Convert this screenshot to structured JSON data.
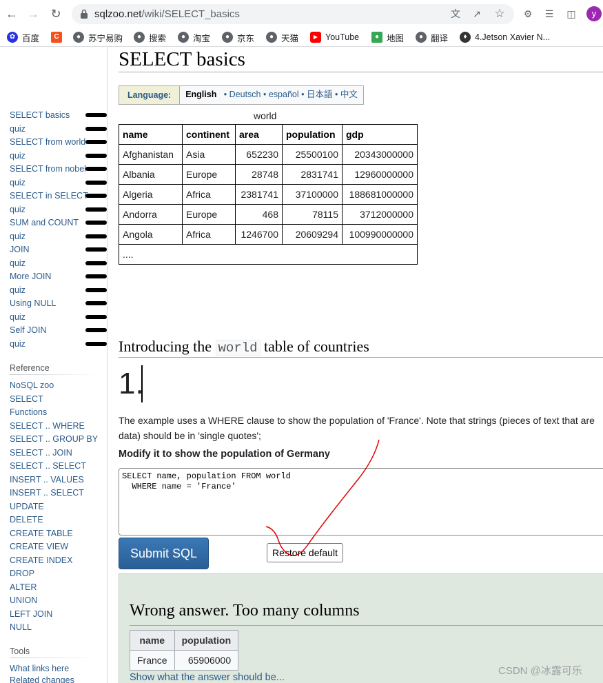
{
  "browser": {
    "url_host": "sqlzoo.net",
    "url_path": "/wiki/SELECT_basics",
    "avatar_letter": "y",
    "bookmarks": [
      {
        "label": "百度",
        "icon": "baidu-icon",
        "color": "#2932e1"
      },
      {
        "label": "",
        "icon": "c-app-icon",
        "color": "#f4511e"
      },
      {
        "label": "苏宁易购",
        "icon": "globe-icon",
        "color": "#5f6368"
      },
      {
        "label": "搜索",
        "icon": "globe-icon",
        "color": "#5f6368"
      },
      {
        "label": "淘宝",
        "icon": "globe-icon",
        "color": "#5f6368"
      },
      {
        "label": "京东",
        "icon": "globe-icon",
        "color": "#5f6368"
      },
      {
        "label": "天猫",
        "icon": "globe-icon",
        "color": "#5f6368"
      },
      {
        "label": "YouTube",
        "icon": "youtube-icon",
        "color": "#ff0000"
      },
      {
        "label": "地图",
        "icon": "maps-icon",
        "color": "#34a853"
      },
      {
        "label": "翻译",
        "icon": "globe-icon",
        "color": "#5f6368"
      },
      {
        "label": "4.Jetson Xavier N...",
        "icon": "bookmark-icon",
        "color": "#333333"
      }
    ]
  },
  "sidebar": {
    "tutorial_links": [
      "SELECT basics",
      "quiz",
      "SELECT from world",
      "quiz",
      "SELECT from nobel",
      "quiz",
      "SELECT in SELECT",
      "quiz",
      "SUM and COUNT",
      "quiz",
      "JOIN",
      "quiz",
      "More JOIN",
      "quiz",
      "Using NULL",
      "quiz",
      "Self JOIN",
      "quiz"
    ],
    "reference_heading": "Reference",
    "reference_links": [
      "NoSQL zoo",
      "SELECT",
      "Functions",
      "SELECT .. WHERE",
      "SELECT .. GROUP BY",
      "SELECT .. JOIN",
      "SELECT .. SELECT",
      "INSERT .. VALUES",
      "INSERT .. SELECT",
      "UPDATE",
      "DELETE",
      "CREATE TABLE",
      "CREATE VIEW",
      "CREATE INDEX",
      "DROP",
      "ALTER",
      "UNION",
      "LEFT JOIN",
      "NULL"
    ],
    "tools_heading": "Tools",
    "tools_links": [
      "What links here",
      "Related changes"
    ]
  },
  "page": {
    "title": "SELECT basics",
    "language": {
      "label": "Language:",
      "current": "English",
      "others": [
        "Deutsch",
        "español",
        "日本語",
        "中文"
      ]
    },
    "world_table": {
      "caption": "world",
      "headers": [
        "name",
        "continent",
        "area",
        "population",
        "gdp"
      ],
      "rows": [
        [
          "Afghanistan",
          "Asia",
          "652230",
          "25500100",
          "20343000000"
        ],
        [
          "Albania",
          "Europe",
          "28748",
          "2831741",
          "12960000000"
        ],
        [
          "Algeria",
          "Africa",
          "2381741",
          "37100000",
          "188681000000"
        ],
        [
          "Andorra",
          "Europe",
          "468",
          "78115",
          "3712000000"
        ],
        [
          "Angola",
          "Africa",
          "1246700",
          "20609294",
          "100990000000"
        ]
      ],
      "ellipsis": "...."
    },
    "section_heading_pre": "Introducing the ",
    "section_heading_code": "world",
    "section_heading_post": " table of countries",
    "question_number": "1.",
    "description": "The example uses a WHERE clause to show the population of 'France'. Note that strings (pieces of text that are",
    "description_line2": "data) should be in 'single quotes';",
    "task": "Modify it to show the population of Germany",
    "sql": "SELECT name, population FROM world\n  WHERE name = 'France'",
    "submit_label": "Submit SQL",
    "restore_label": "Restore default",
    "result": {
      "title": "Wrong answer. Too many columns",
      "headers": [
        "name",
        "population"
      ],
      "rows": [
        [
          "France",
          "65906000"
        ]
      ],
      "link": "Show what the answer should be..."
    }
  },
  "watermark": "CSDN @冰露可乐"
}
